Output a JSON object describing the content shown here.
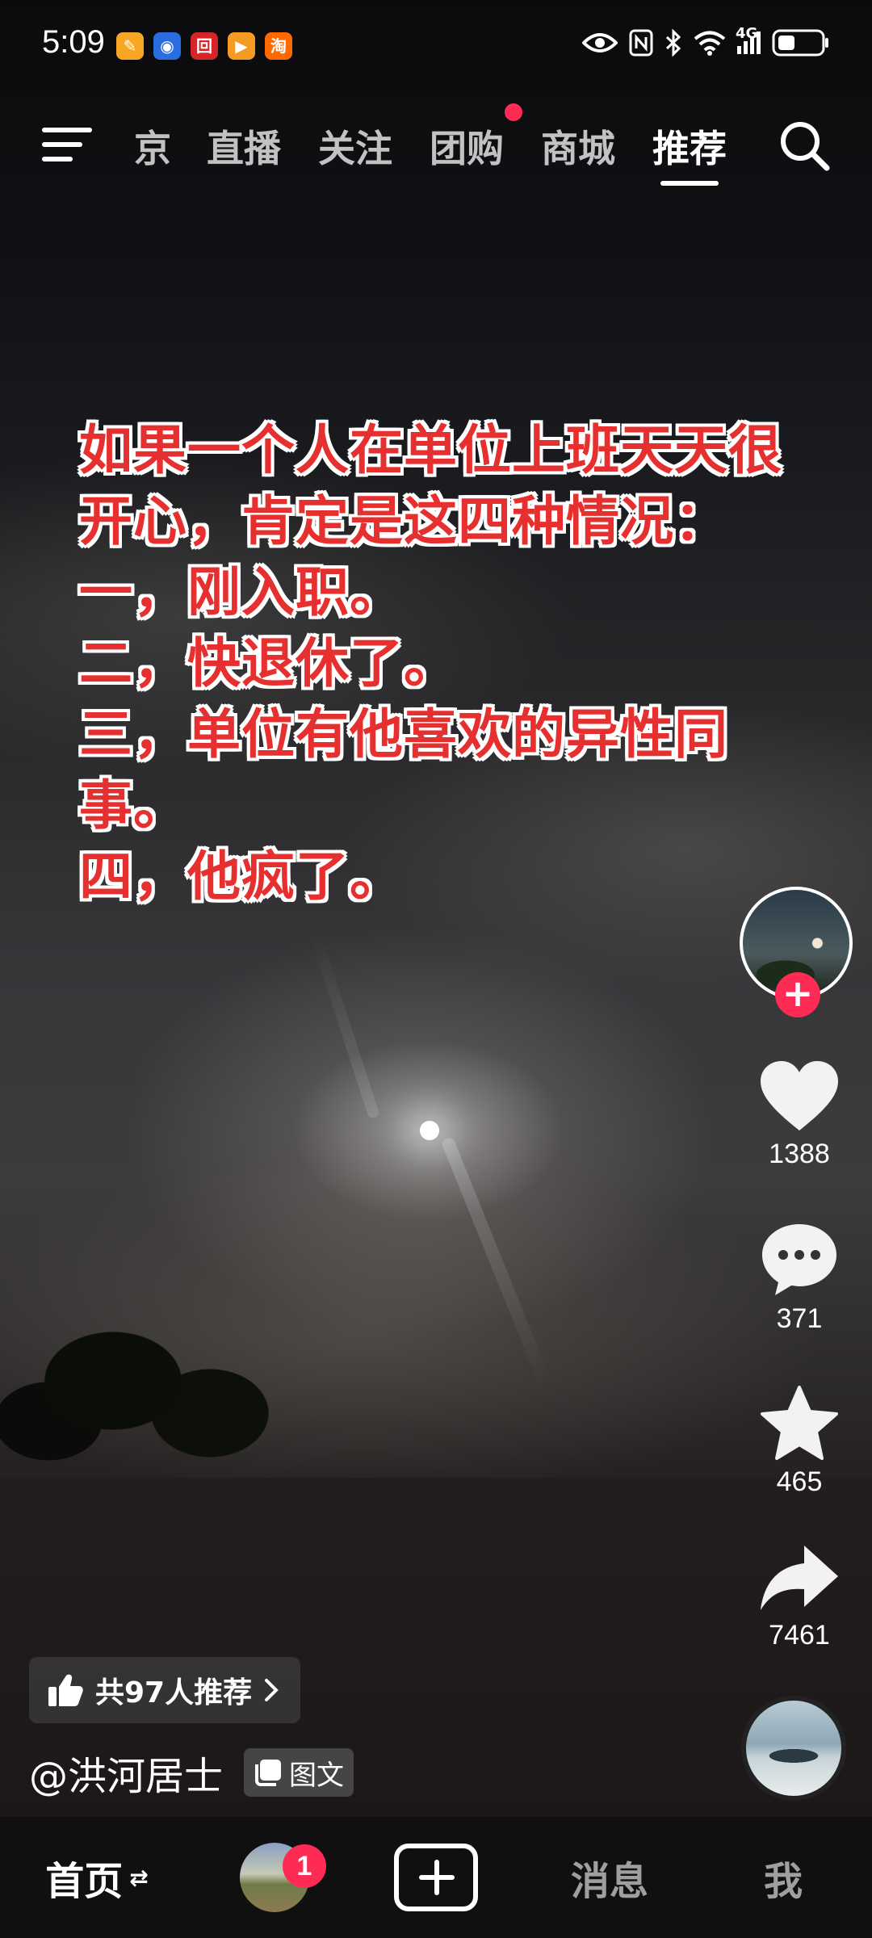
{
  "status_bar": {
    "time": "5:09",
    "notification_icons": [
      {
        "name": "app-icon-1",
        "glyph": "✎",
        "color": "#f6a623"
      },
      {
        "name": "app-icon-2",
        "glyph": "◉",
        "color": "#2a6de0"
      },
      {
        "name": "app-icon-3",
        "glyph": "回",
        "color": "#d6242a"
      },
      {
        "name": "app-icon-4",
        "glyph": "▶",
        "color": "#f59a23"
      },
      {
        "name": "taobao-icon",
        "glyph": "淘",
        "color": "#ff6a00"
      }
    ],
    "network": "4G"
  },
  "top_nav": {
    "tabs": [
      "京",
      "直播",
      "关注",
      "团购",
      "商城",
      "推荐"
    ],
    "active_tab": "推荐"
  },
  "post": {
    "overlay_lines": [
      "如果一个人在单位上班天天很",
      "开心，肯定是这四种情况：",
      "一，刚入职。",
      "二，快退休了。",
      "三，单位有他喜欢的异性同",
      "事。",
      "四，他疯了。"
    ],
    "recommend_text": "共97人推荐",
    "author": "@洪河居士",
    "post_type": "图文"
  },
  "actions": {
    "likes": "1388",
    "comments": "371",
    "favorites": "465",
    "shares": "7461"
  },
  "bottom_nav": {
    "home": "首页",
    "home_suffix": "⇄",
    "friends_badge": "1",
    "messages": "消息",
    "me": "我"
  },
  "colors": {
    "accent": "#fe2c55",
    "overlay_text": "#e5302f"
  }
}
